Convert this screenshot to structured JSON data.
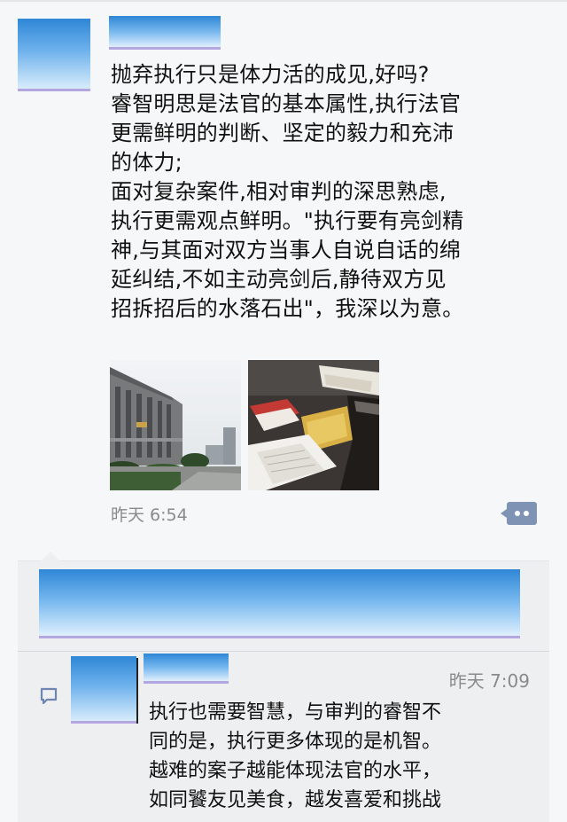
{
  "post": {
    "text_lines": [
      "抛弃执行只是体力活的成见,好吗?",
      "睿智明思是法官的基本属性,执行法官",
      "更需鲜明的判断、坚定的毅力和充沛",
      "的体力;",
      "面对复杂案件,相对审判的深思熟虑,",
      "执行更需观点鲜明。\"执行要有亮剑精",
      "神,与其面对双方当事人自说自话的绵",
      "延纠结,不如主动亮剑后,静待双方见",
      "招拆招后的水落石出\"，我深以为意。"
    ],
    "photos": [
      "court-building-photo",
      "desk-case-files-photo"
    ],
    "timestamp": "昨天 6:54"
  },
  "comment": {
    "time": "昨天 7:09",
    "text_lines": [
      "执行也需要智慧，与审判的睿智不",
      "同的是，执行更多体现的是机智。",
      "越难的案子越能体现法官的水平，",
      "如同饕友见美食，越发喜爱和挑战"
    ]
  },
  "colors": {
    "accent": "#7f93b5",
    "timestamp": "#8a8a8a",
    "comment_bg": "#eeeff1"
  },
  "icons": {
    "comment_action": "comment-dots-icon",
    "comment_marker": "speech-bubble-icon"
  }
}
